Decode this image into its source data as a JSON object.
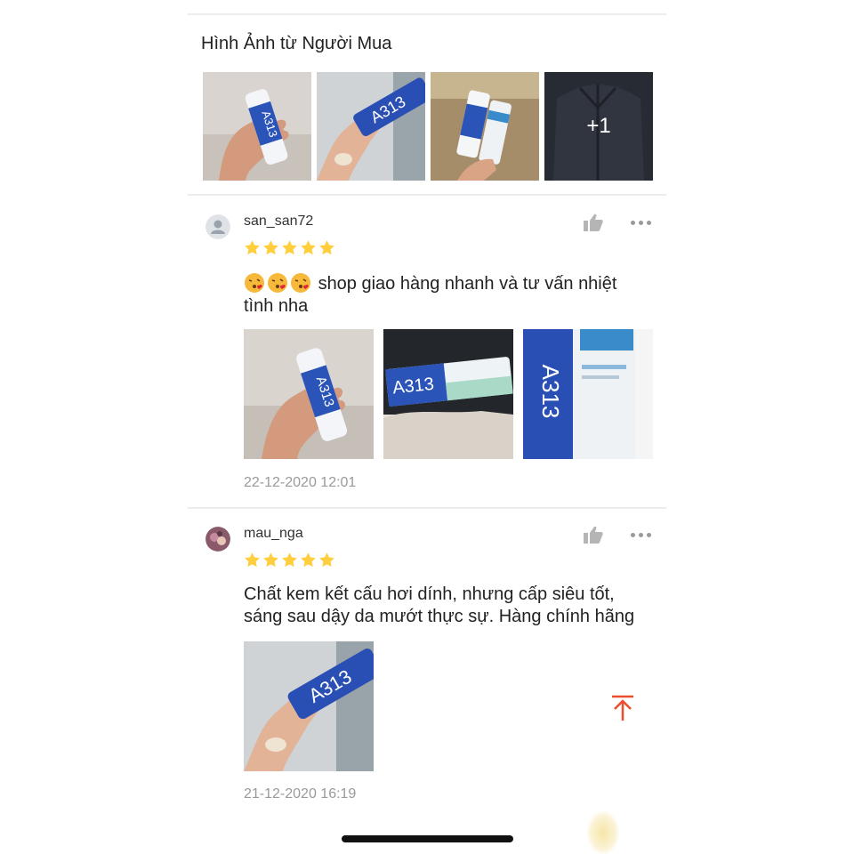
{
  "section": {
    "title": "Hình Ảnh từ Người Mua",
    "more_count": "+1"
  },
  "reviews": [
    {
      "username": "san_san72",
      "rating": 5,
      "emoji_count": 3,
      "text_line1": "shop giao hàng nhanh và tư vấn nhiệt",
      "text_line2": "tình nha",
      "timestamp": "22-12-2020 12:01"
    },
    {
      "username": "mau_nga",
      "rating": 5,
      "text_line1": "Chất kem kết cấu hơi dính, nhưng cấp siêu tốt,",
      "text_line2": "sáng sau dậy da mướt thực sự. Hàng chính hãng",
      "timestamp": "21-12-2020 16:19"
    }
  ],
  "product_label": "A313",
  "colors": {
    "accent": "#ee4d2d",
    "star": "#ffce3d",
    "product_blue": "#1f4fa8"
  }
}
